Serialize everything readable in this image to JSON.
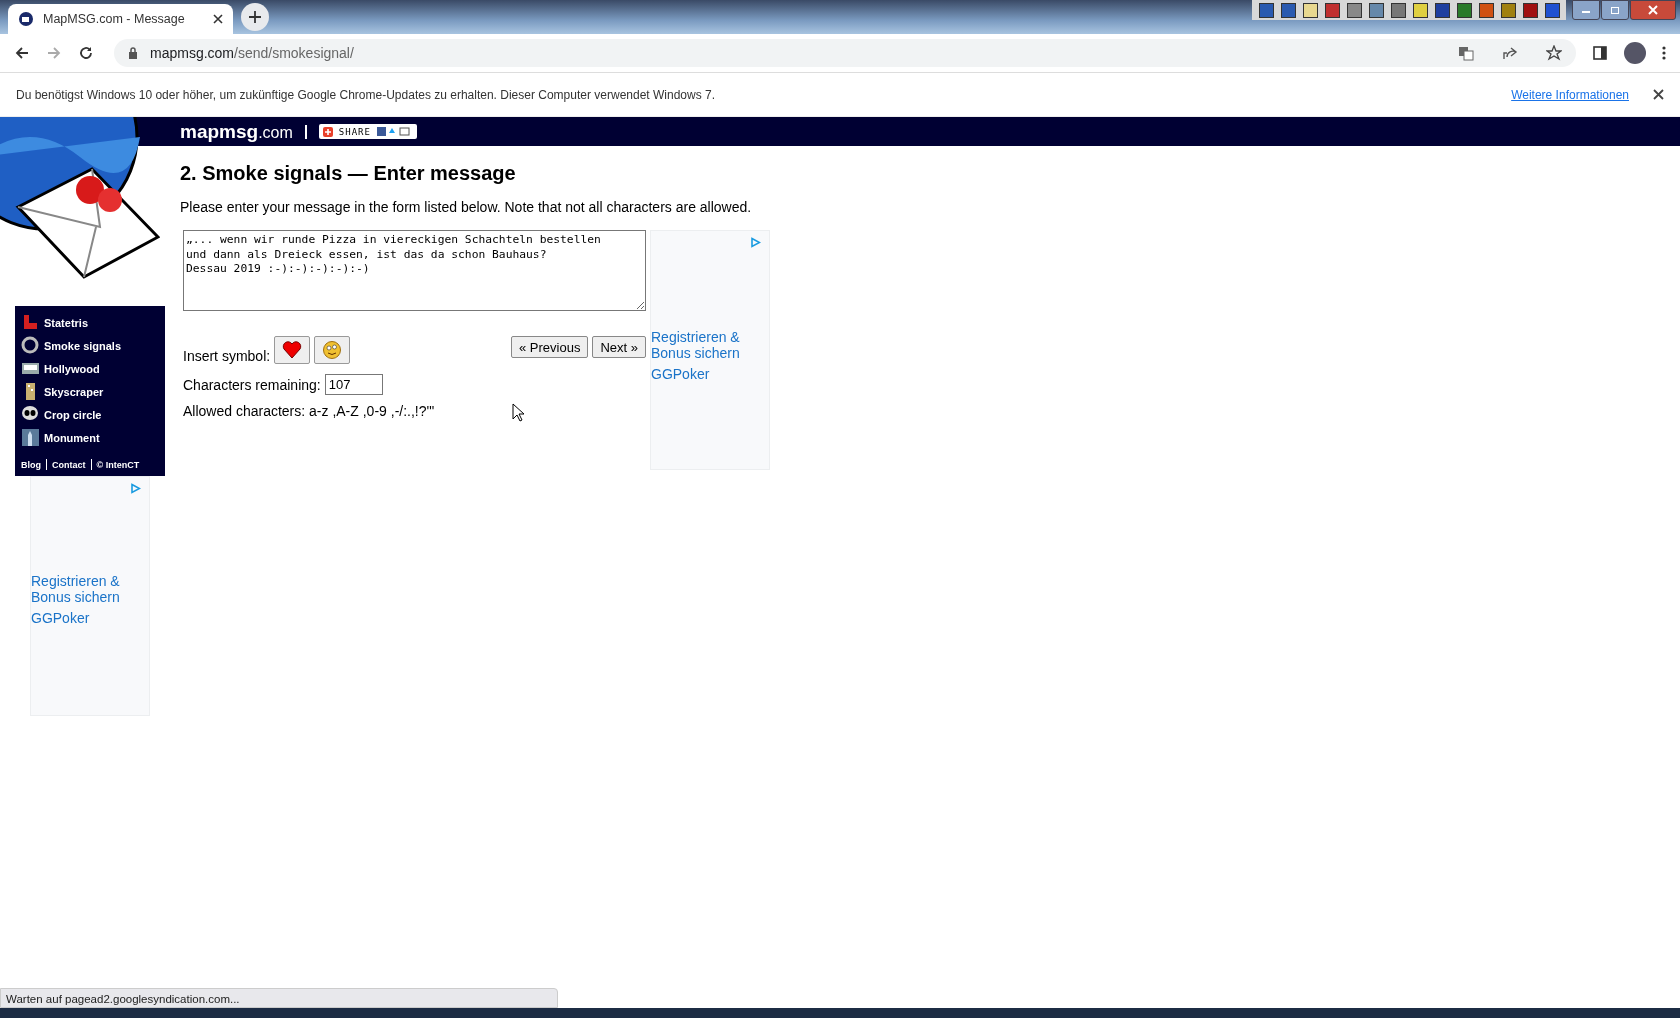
{
  "browser": {
    "tab_title": "MapMSG.com - Message",
    "url_host": "mapmsg.com",
    "url_path": "/send/smokesignal/"
  },
  "infobar": {
    "message": "Du benötigst Windows 10 oder höher, um zukünftige Google Chrome-Updates zu erhalten. Dieser Computer verwendet Windows 7.",
    "link": "Weitere Informationen"
  },
  "site": {
    "logo_main": "mapmsg",
    "logo_suffix": ".com",
    "share_label": "SHARE"
  },
  "nav": {
    "items": [
      {
        "label": "Statetris",
        "kind": "tetris"
      },
      {
        "label": "Smoke signals",
        "kind": "ring"
      },
      {
        "label": "Hollywood",
        "kind": "sign"
      },
      {
        "label": "Skyscraper",
        "kind": "building"
      },
      {
        "label": "Crop circle",
        "kind": "alien"
      },
      {
        "label": "Monument",
        "kind": "statue"
      }
    ],
    "footer_links": [
      "Blog",
      "Contact",
      "© IntenCT"
    ]
  },
  "page": {
    "heading": "2. Smoke signals — Enter message",
    "intro": "Please enter your message in the form listed below. Note that not all characters are allowed.",
    "message": "„... wenn wir runde Pizza in viereckigen Schachteln bestellen\nund dann als Dreieck essen, ist das da schon Bauhaus?\nDessau 2019 :-):-):-):-):-)",
    "insert_label": "Insert symbol:",
    "symbols": [
      {
        "kind": "heart"
      },
      {
        "kind": "smiley"
      }
    ],
    "buttons": [
      "« Previous",
      "Next »"
    ],
    "remaining_label": "Characters remaining:",
    "remaining": "107",
    "allowed": "Allowed characters: a-z ,A-Z ,0-9 ,-/:.,!?'\""
  },
  "ads": [
    {
      "line1": "Registrieren & Bonus sichern",
      "line2": "GGPoker"
    },
    {
      "line1": "Registrieren & Bonus sichern",
      "line2": "GGPoker"
    }
  ],
  "status_bar": "Warten auf pagead2.googlesyndication.com..."
}
